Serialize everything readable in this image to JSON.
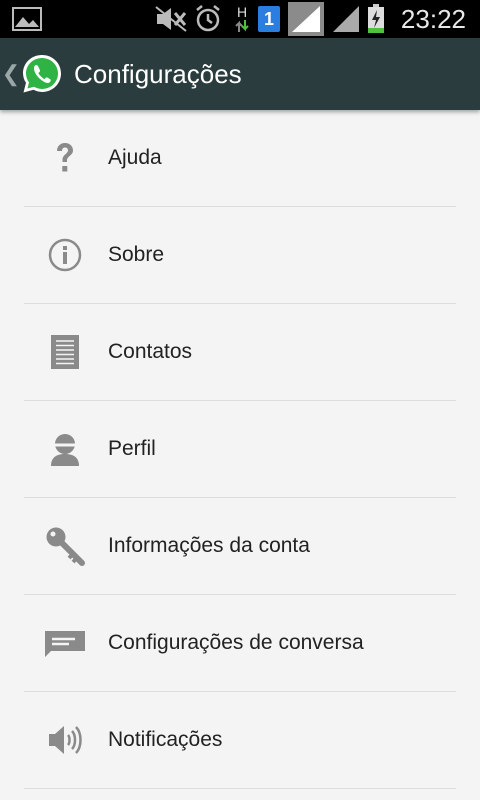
{
  "status_bar": {
    "time": "23:22",
    "network_label": "H",
    "sim_badge": "1",
    "icons": [
      "gallery-icon",
      "mute-icon",
      "alarm-icon",
      "data-arrows-icon",
      "sim-badge-icon",
      "signal-sim1-icon",
      "signal-sim2-icon",
      "battery-charging-icon"
    ]
  },
  "action_bar": {
    "title": "Configurações",
    "back_icon": "chevron-left-icon",
    "logo_icon": "whatsapp-logo-icon"
  },
  "settings": {
    "items": [
      {
        "label": "Ajuda",
        "icon": "help-icon"
      },
      {
        "label": "Sobre",
        "icon": "info-icon"
      },
      {
        "label": "Contatos",
        "icon": "contacts-list-icon"
      },
      {
        "label": "Perfil",
        "icon": "profile-icon"
      },
      {
        "label": "Informações da conta",
        "icon": "key-icon"
      },
      {
        "label": "Configurações de conversa",
        "icon": "chat-icon"
      },
      {
        "label": "Notificações",
        "icon": "speaker-icon"
      }
    ]
  },
  "colors": {
    "action_bar": "#2b3c3f",
    "background": "#f4f4f4",
    "icon_gray": "#8a8a8a",
    "whatsapp_green": "#2fb344"
  }
}
